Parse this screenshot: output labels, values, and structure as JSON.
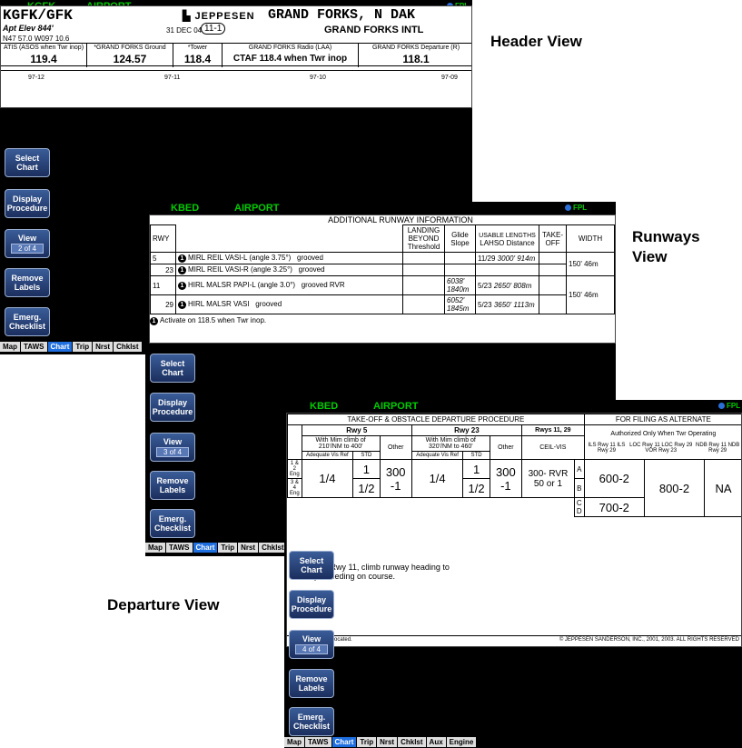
{
  "labels": {
    "header_view": "Header View",
    "runways_view": "Runways View",
    "departure_view": "Departure View"
  },
  "screen1": {
    "title_left": "KGFK",
    "title_mid": "AIRPORT",
    "fpl": "FPL",
    "ident": "KGFK/GFK",
    "elev": "Apt Elev 844'",
    "coords": "N47 57.0 W097 10.6",
    "brand": "JEPPESEN",
    "date": "31 DEC 04",
    "page": "11-1",
    "city": "GRAND FORKS, N DAK",
    "airport": "GRAND FORKS INTL",
    "freqs": [
      {
        "name": "ATIS (ASOS when Twr inop)",
        "value": "119.4"
      },
      {
        "name": "*GRAND FORKS Ground",
        "value": "124.57"
      },
      {
        "name": "*Tower",
        "value": "118.4"
      },
      {
        "name": "GRAND FORKS Radio (LAA)",
        "value": "CTAF 118.4 when Twr inop"
      },
      {
        "name": "GRAND FORKS Departure (R)",
        "value": "118.1"
      }
    ],
    "ruler": [
      "97-12",
      "97-11",
      "97-10",
      "97-09"
    ],
    "buttons": [
      {
        "label": "Select Chart"
      },
      {
        "label": "Display Procedure"
      },
      {
        "label": "View",
        "sub": "2 of 4"
      },
      {
        "label": "Remove Labels"
      },
      {
        "label": "Emerg. Checklist"
      }
    ],
    "tabs": [
      "Map",
      "TAWS",
      "Chart",
      "Trip",
      "Nrst",
      "Chklst"
    ]
  },
  "screen2": {
    "title_left": "KBED",
    "title_mid": "AIRPORT",
    "fpl": "FPL",
    "heading": "ADDITIONAL RUNWAY INFORMATION",
    "usable": "USABLE LENGTHS",
    "cols": {
      "rwy": "RWY",
      "landing": "LANDING BEYOND",
      "threshold": "Threshold",
      "glide": "Glide Slope",
      "lahso": "LAHSO Distance",
      "takeoff": "TAKE-OFF",
      "width": "WIDTH"
    },
    "rows": [
      {
        "rwy": "5",
        "lights": "MIRL  REIL  VASI-L (angle 3.75°)",
        "surface": "grooved",
        "glide": "",
        "lahso_rwy": "11/29",
        "lahso_dist": "3000' 914m",
        "width": "150' 46m"
      },
      {
        "rwy": "23",
        "lights": "MIRL  REIL  VASI-R (angle 3.25°)",
        "surface": "grooved",
        "glide": "",
        "lahso_rwy": "",
        "lahso_dist": "",
        "width": ""
      },
      {
        "rwy": "11",
        "lights": "HIRL  MALSR  PAPI-L (angle 3.0°)",
        "surface": "grooved  RVR",
        "glide": "6038' 1840m",
        "lahso_rwy": "5/23",
        "lahso_dist": "2650' 808m",
        "width": "150' 46m"
      },
      {
        "rwy": "29",
        "lights": "HIRL  MALSR  VASI",
        "surface": "grooved",
        "glide": "6052' 1845m",
        "lahso_rwy": "5/23",
        "lahso_dist": "3650' 1113m",
        "width": ""
      }
    ],
    "note": "Activate on 118.5 when Twr inop.",
    "buttons": [
      {
        "label": "Select Chart"
      },
      {
        "label": "Display Procedure"
      },
      {
        "label": "View",
        "sub": "3 of 4"
      },
      {
        "label": "Remove Labels"
      },
      {
        "label": "Emerg. Checklist"
      }
    ],
    "tabs": [
      "Map",
      "TAWS",
      "Chart",
      "Trip",
      "Nrst",
      "Chklst"
    ]
  },
  "screen3": {
    "title_left": "KBED",
    "title_mid": "AIRPORT",
    "fpl": "FPL",
    "takeoff_head": "TAKE-OFF & OBSTACLE DEPARTURE PROCEDURE",
    "alt_head": "FOR FILING AS ALTERNATE",
    "rwy5": "Rwy 5",
    "rwy23": "Rwy 23",
    "rwys": "Rwys 11, 29",
    "with5": "With Mim climb of 210'/NM to 400'",
    "with23": "With Mim climb of 320'/NM to 460'",
    "other": "Other",
    "ceil": "CEIL-VIS",
    "adequate": "Adequate Vis Ref",
    "std": "STD",
    "auth": "Authorized Only When Twr Operating",
    "ils": "ILS Rwy 11 ILS Rwy 29",
    "loc": "LOC Rwy 11 LOC Rwy 29 VOR Rwy 23",
    "ndb": "NDB Rwy 11 NDB Rwy 29",
    "eng12": "1 & 2 Eng",
    "eng34": "3 & 4 Eng",
    "v14a": "1/4",
    "v1": "1",
    "v12": "1/2",
    "v300": "300 -1",
    "v14b": "1/4",
    "v1b": "1",
    "v12b": "1/2",
    "v300b": "300 -1",
    "ceilv": "300- RVR 50 or 1",
    "abcd": [
      "A",
      "B",
      "C",
      "D"
    ],
    "m600": "600-2",
    "m800": "800-2",
    "na": "NA",
    "m700": "700-2",
    "dp": "DP: Rwy 11, climb runway heading to",
    "dp2": "proceeding on course.",
    "foot_left": "IS, notes, tower relocated.",
    "foot_right": "© JEPPESEN SANDERSON, INC., 2001, 2003. ALL RIGHTS RESERVED",
    "buttons": [
      {
        "label": "Select Chart"
      },
      {
        "label": "Display Procedure"
      },
      {
        "label": "View",
        "sub": "4 of 4"
      },
      {
        "label": "Remove Labels"
      },
      {
        "label": "Emerg. Checklist"
      }
    ],
    "tabs": [
      "Map",
      "TAWS",
      "Chart",
      "Trip",
      "Nrst",
      "Chklst",
      "Aux",
      "Engine"
    ]
  }
}
